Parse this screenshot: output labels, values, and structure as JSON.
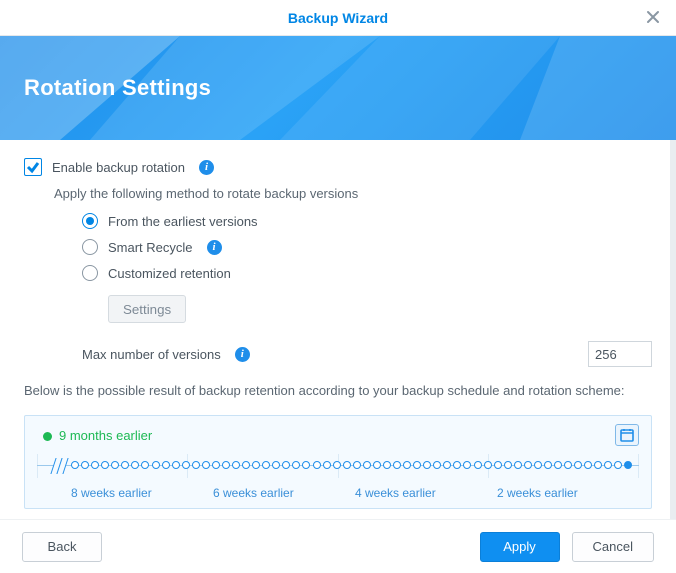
{
  "window": {
    "title": "Backup Wizard"
  },
  "header": {
    "title": "Rotation Settings"
  },
  "rotation": {
    "enable_label": "Enable backup rotation",
    "apply_desc": "Apply the following method to rotate backup versions",
    "options": {
      "earliest": "From the earliest versions",
      "smart": "Smart Recycle",
      "custom": "Customized retention"
    },
    "settings_btn": "Settings",
    "max_label": "Max number of versions",
    "max_value": "256"
  },
  "preview": {
    "explain": "Below is the possible result of backup retention according to your backup schedule and rotation scheme:",
    "earliest": "9 months earlier",
    "ticks": [
      "8 weeks earlier",
      "6 weeks earlier",
      "4 weeks earlier",
      "2 weeks earlier"
    ]
  },
  "footer": {
    "back": "Back",
    "apply": "Apply",
    "cancel": "Cancel"
  }
}
